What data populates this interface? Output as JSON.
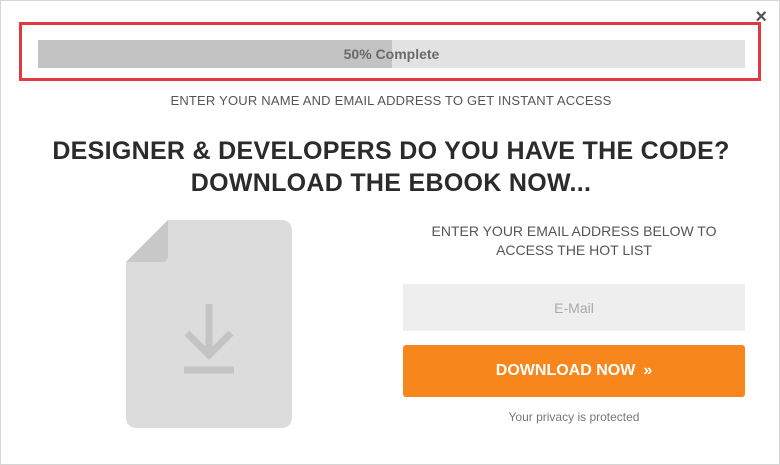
{
  "popup": {
    "close_icon": "×",
    "progress": {
      "percent": 50,
      "label": "50% Complete"
    },
    "subheading": "ENTER YOUR NAME AND EMAIL ADDRESS TO GET INSTANT ACCESS",
    "headline_line1": "DESIGNER & DEVELOPERS DO YOU HAVE THE CODE?",
    "headline_line2": "DOWNLOAD THE EBOOK NOW...",
    "form": {
      "heading_line1": "ENTER YOUR EMAIL ADDRESS BELOW TO",
      "heading_line2": "ACCESS THE HOT LIST",
      "email_placeholder": "E-Mail",
      "button_label": "DOWNLOAD NOW",
      "button_arrow": "»",
      "privacy": "Your privacy is protected"
    },
    "colors": {
      "accent": "#f7861d",
      "highlight": "#e03a3e"
    },
    "icons": [
      "close-icon",
      "file-download-icon"
    ]
  }
}
